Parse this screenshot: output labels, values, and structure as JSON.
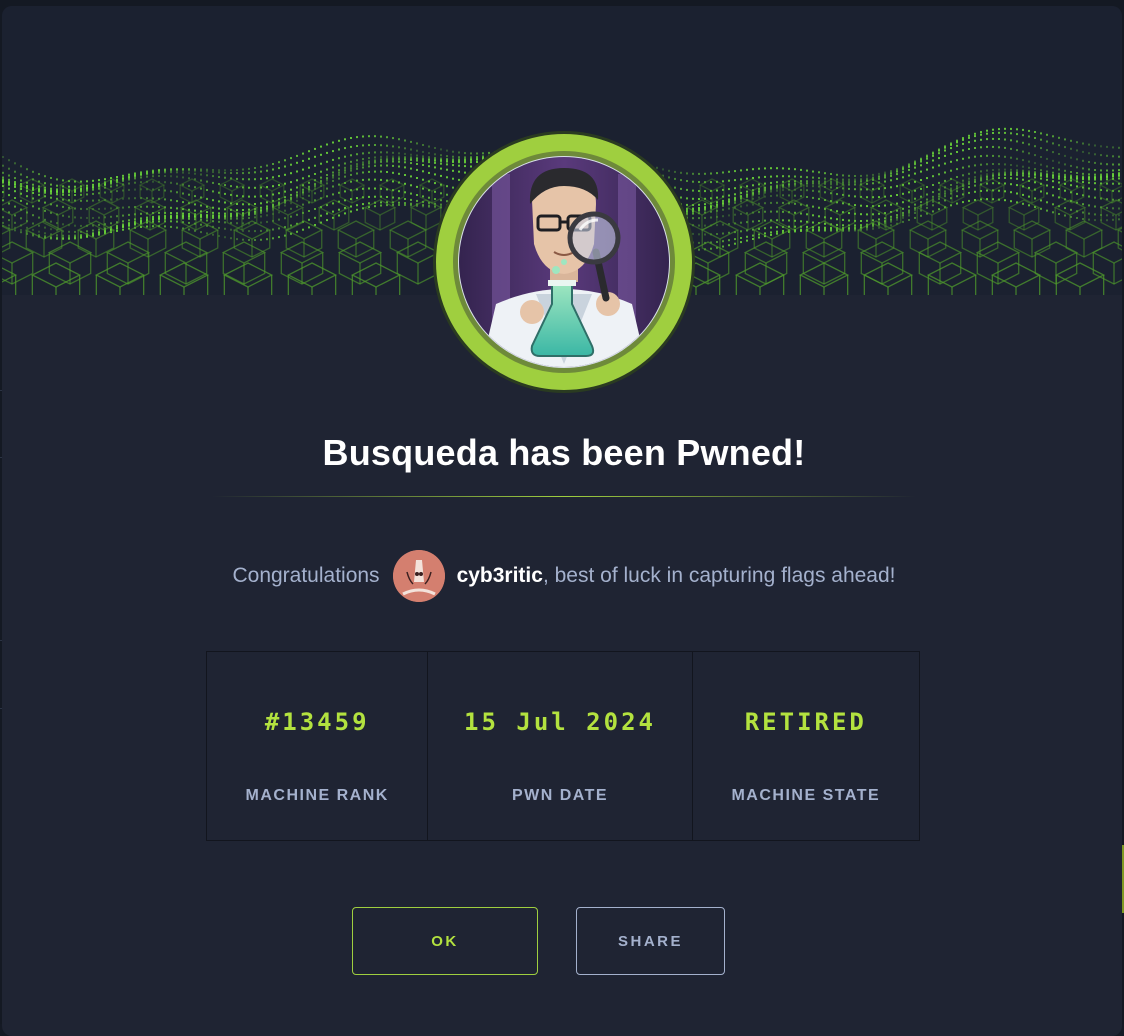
{
  "modal": {
    "title": "Busqueda has been Pwned!",
    "congrats_lead": "Congratulations",
    "username": "cyb3ritic",
    "congrats_tail": ", best of luck in capturing flags ahead!",
    "stats": [
      {
        "value": "#13459",
        "label": "MACHINE RANK"
      },
      {
        "value": "15 Jul 2024",
        "label": "PWN DATE"
      },
      {
        "value": "RETIRED",
        "label": "MACHINE STATE"
      }
    ],
    "buttons": {
      "ok_label": "OK",
      "share_label": "SHARE"
    }
  },
  "icons": {
    "machine_avatar": "scientist-magnifier-icon",
    "user_avatar": "user-avatar-icon"
  },
  "colors": {
    "accent": "#9fcf3f",
    "stat_value": "#b3e23f",
    "panel": "#1f2433",
    "muted_text": "#a4b1cd"
  }
}
